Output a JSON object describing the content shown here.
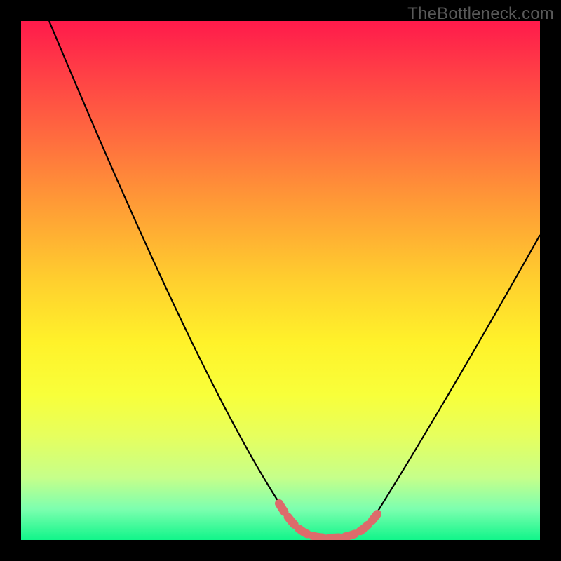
{
  "watermark": "TheBottleneck.com",
  "chart_data": {
    "type": "line",
    "title": "",
    "xlabel": "",
    "ylabel": "",
    "xlim": [
      0,
      100
    ],
    "ylim": [
      0,
      100
    ],
    "x": [
      0,
      5,
      10,
      15,
      20,
      25,
      30,
      35,
      40,
      45,
      50,
      52,
      54,
      56,
      58,
      60,
      62,
      64,
      66,
      70,
      75,
      80,
      85,
      90,
      95,
      100
    ],
    "values": [
      100,
      91,
      82,
      73,
      64,
      55,
      46,
      37,
      28,
      19,
      10,
      6,
      3,
      1,
      0,
      0,
      0,
      0,
      1,
      4,
      10,
      18,
      27,
      37,
      48,
      59
    ],
    "marker_segment": {
      "x": [
        50,
        52,
        54,
        56,
        58,
        60,
        62,
        64,
        66
      ],
      "values": [
        10,
        6,
        3,
        1,
        0,
        0,
        0,
        0,
        1
      ],
      "color": "#e06666"
    },
    "background_gradient": [
      "#ff1a4b",
      "#fff22a",
      "#11f58a"
    ]
  }
}
